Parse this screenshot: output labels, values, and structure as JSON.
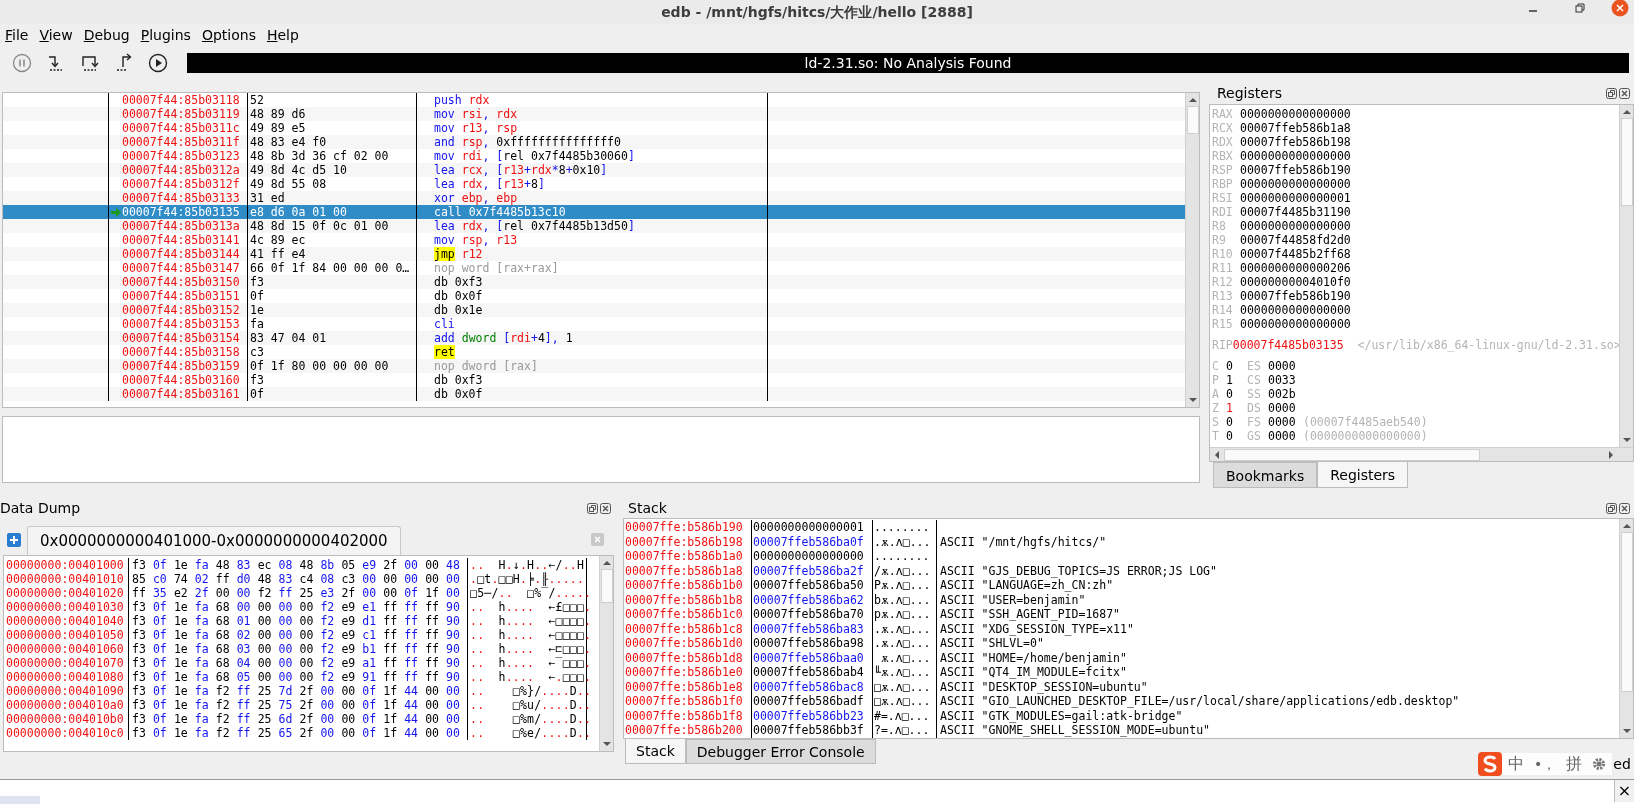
{
  "window": {
    "title": "edb - /mnt/hgfs/hitcs/大作业/hello [2888]"
  },
  "menu": [
    "File",
    "View",
    "Debug",
    "Plugins",
    "Options",
    "Help"
  ],
  "toolbar": {
    "status": "ld-2.31.so: No Analysis Found"
  },
  "disassembly": {
    "rows": [
      {
        "address": "00007f44:85b03118",
        "bytes": "52",
        "asm": [
          {
            "kind": "mnemonic",
            "text": "push "
          },
          {
            "kind": "register",
            "text": "rdx"
          }
        ],
        "selected": false,
        "current": false
      },
      {
        "address": "00007f44:85b03119",
        "bytes": "48 89 d6",
        "asm": [
          {
            "kind": "mnemonic",
            "text": "mov "
          },
          {
            "kind": "register",
            "text": "rsi"
          },
          {
            "kind": "punct",
            "text": ", "
          },
          {
            "kind": "register",
            "text": "rdx"
          }
        ],
        "selected": false,
        "current": false
      },
      {
        "address": "00007f44:85b0311c",
        "bytes": "49 89 e5",
        "asm": [
          {
            "kind": "mnemonic",
            "text": "mov "
          },
          {
            "kind": "register",
            "text": "r13"
          },
          {
            "kind": "punct",
            "text": ", "
          },
          {
            "kind": "register",
            "text": "rsp"
          }
        ],
        "selected": false,
        "current": false
      },
      {
        "address": "00007f44:85b0311f",
        "bytes": "48 83 e4 f0",
        "asm": [
          {
            "kind": "mnemonic",
            "text": "and "
          },
          {
            "kind": "register",
            "text": "rsp"
          },
          {
            "kind": "punct",
            "text": ", "
          },
          {
            "kind": "number",
            "text": "0xfffffffffffffff0"
          }
        ],
        "selected": false,
        "current": false
      },
      {
        "address": "00007f44:85b03123",
        "bytes": "48 8b 3d 36 cf 02 00",
        "asm": [
          {
            "kind": "mnemonic",
            "text": "mov "
          },
          {
            "kind": "register",
            "text": "rdi"
          },
          {
            "kind": "punct",
            "text": ", ["
          },
          {
            "kind": "number",
            "text": "rel 0x7f4485b30060"
          },
          {
            "kind": "punct",
            "text": "]"
          }
        ],
        "selected": false,
        "current": false
      },
      {
        "address": "00007f44:85b0312a",
        "bytes": "49 8d 4c d5 10",
        "asm": [
          {
            "kind": "mnemonic",
            "text": "lea "
          },
          {
            "kind": "register",
            "text": "rcx"
          },
          {
            "kind": "punct",
            "text": ", ["
          },
          {
            "kind": "register",
            "text": "r13"
          },
          {
            "kind": "punct",
            "text": "+"
          },
          {
            "kind": "register",
            "text": "rdx"
          },
          {
            "kind": "punct",
            "text": "*"
          },
          {
            "kind": "number",
            "text": "8"
          },
          {
            "kind": "punct",
            "text": "+"
          },
          {
            "kind": "number",
            "text": "0x10"
          },
          {
            "kind": "punct",
            "text": "]"
          }
        ],
        "selected": false,
        "current": false
      },
      {
        "address": "00007f44:85b0312f",
        "bytes": "49 8d 55 08",
        "asm": [
          {
            "kind": "mnemonic",
            "text": "lea "
          },
          {
            "kind": "register",
            "text": "rdx"
          },
          {
            "kind": "punct",
            "text": ", ["
          },
          {
            "kind": "register",
            "text": "r13"
          },
          {
            "kind": "punct",
            "text": "+"
          },
          {
            "kind": "number",
            "text": "8"
          },
          {
            "kind": "punct",
            "text": "]"
          }
        ],
        "selected": false,
        "current": false
      },
      {
        "address": "00007f44:85b03133",
        "bytes": "31 ed",
        "asm": [
          {
            "kind": "mnemonic",
            "text": "xor "
          },
          {
            "kind": "register",
            "text": "ebp"
          },
          {
            "kind": "punct",
            "text": ", "
          },
          {
            "kind": "register",
            "text": "ebp"
          }
        ],
        "selected": false,
        "current": false
      },
      {
        "address": "00007f44:85b03135",
        "bytes": "e8 d6 0a 01 00",
        "asm": [
          {
            "kind": "mnemonic",
            "text": "call "
          },
          {
            "kind": "number",
            "text": "0x7f4485b13c10"
          }
        ],
        "selected": true,
        "current": true
      },
      {
        "address": "00007f44:85b0313a",
        "bytes": "48 8d 15 0f 0c 01 00",
        "asm": [
          {
            "kind": "mnemonic",
            "text": "lea "
          },
          {
            "kind": "register",
            "text": "rdx"
          },
          {
            "kind": "punct",
            "text": ", ["
          },
          {
            "kind": "number",
            "text": "rel 0x7f4485b13d50"
          },
          {
            "kind": "punct",
            "text": "]"
          }
        ],
        "selected": false,
        "current": false
      },
      {
        "address": "00007f44:85b03141",
        "bytes": "4c 89 ec",
        "asm": [
          {
            "kind": "mnemonic",
            "text": "mov "
          },
          {
            "kind": "register",
            "text": "rsp"
          },
          {
            "kind": "punct",
            "text": ", "
          },
          {
            "kind": "register",
            "text": "r13"
          }
        ],
        "selected": false,
        "current": false
      },
      {
        "address": "00007f44:85b03144",
        "bytes": "41 ff e4",
        "asm": [
          {
            "kind": "highlight",
            "text": "jmp"
          },
          {
            "kind": "register",
            "text": " r12"
          }
        ],
        "selected": false,
        "current": false
      },
      {
        "address": "00007f44:85b03147",
        "bytes": "66 0f 1f 84 00 00 00 0…",
        "asm": [
          {
            "kind": "dim",
            "text": "nop word [rax+rax]"
          }
        ],
        "selected": false,
        "current": false
      },
      {
        "address": "00007f44:85b03150",
        "bytes": "f3",
        "asm": [
          {
            "kind": "number",
            "text": "db 0xf3"
          }
        ],
        "selected": false,
        "current": false
      },
      {
        "address": "00007f44:85b03151",
        "bytes": "0f",
        "asm": [
          {
            "kind": "number",
            "text": "db 0x0f"
          }
        ],
        "selected": false,
        "current": false
      },
      {
        "address": "00007f44:85b03152",
        "bytes": "1e",
        "asm": [
          {
            "kind": "number",
            "text": "db 0x1e"
          }
        ],
        "selected": false,
        "current": false
      },
      {
        "address": "00007f44:85b03153",
        "bytes": "fa",
        "asm": [
          {
            "kind": "mnemonic",
            "text": "cli"
          }
        ],
        "selected": false,
        "current": false
      },
      {
        "address": "00007f44:85b03154",
        "bytes": "83 47 04 01",
        "asm": [
          {
            "kind": "mnemonic",
            "text": "add "
          },
          {
            "kind": "size",
            "text": "dword "
          },
          {
            "kind": "punct",
            "text": "["
          },
          {
            "kind": "register",
            "text": "rdi"
          },
          {
            "kind": "punct",
            "text": "+"
          },
          {
            "kind": "number",
            "text": "4"
          },
          {
            "kind": "punct",
            "text": "], "
          },
          {
            "kind": "number",
            "text": "1"
          }
        ],
        "selected": false,
        "current": false
      },
      {
        "address": "00007f44:85b03158",
        "bytes": "c3",
        "asm": [
          {
            "kind": "highlight",
            "text": "ret"
          }
        ],
        "selected": false,
        "current": false
      },
      {
        "address": "00007f44:85b03159",
        "bytes": "0f 1f 80 00 00 00 00",
        "asm": [
          {
            "kind": "dim",
            "text": "nop dword [rax]"
          }
        ],
        "selected": false,
        "current": false
      },
      {
        "address": "00007f44:85b03160",
        "bytes": "f3",
        "asm": [
          {
            "kind": "number",
            "text": "db 0xf3"
          }
        ],
        "selected": false,
        "current": false
      },
      {
        "address": "00007f44:85b03161",
        "bytes": "0f",
        "asm": [
          {
            "kind": "number",
            "text": "db 0x0f"
          }
        ],
        "selected": false,
        "current": false
      }
    ]
  },
  "registers": {
    "title": "Registers",
    "general": [
      {
        "name": "RAX",
        "value": "0000000000000000"
      },
      {
        "name": "RCX",
        "value": "00007ffeb586b1a8"
      },
      {
        "name": "RDX",
        "value": "00007ffeb586b198"
      },
      {
        "name": "RBX",
        "value": "0000000000000000"
      },
      {
        "name": "RSP",
        "value": "00007ffeb586b190"
      },
      {
        "name": "RBP",
        "value": "0000000000000000"
      },
      {
        "name": "RSI",
        "value": "0000000000000001"
      },
      {
        "name": "RDI",
        "value": "00007f4485b31190"
      },
      {
        "name": "R8",
        "value": "0000000000000000"
      },
      {
        "name": "R9",
        "value": "00007f44858fd2d0"
      },
      {
        "name": "R10",
        "value": "00007f4485b2ff68"
      },
      {
        "name": "R11",
        "value": "0000000000000206"
      },
      {
        "name": "R12",
        "value": "00000000004010f0"
      },
      {
        "name": "R13",
        "value": "00007ffeb586b190"
      },
      {
        "name": "R14",
        "value": "0000000000000000"
      },
      {
        "name": "R15",
        "value": "0000000000000000"
      }
    ],
    "rip": {
      "name": "RIP",
      "value": "00007f4485b03135",
      "comment": "</usr/lib/x86_64-linux-gnu/ld-2.31.so>"
    },
    "flags": [
      {
        "flag": "C",
        "value": "0",
        "changed": false,
        "segment": "ES",
        "segment_value": "0000"
      },
      {
        "flag": "P",
        "value": "1",
        "changed": false,
        "segment": "CS",
        "segment_value": "0033"
      },
      {
        "flag": "A",
        "value": "0",
        "changed": false,
        "segment": "SS",
        "segment_value": "002b"
      },
      {
        "flag": "Z",
        "value": "1",
        "changed": true,
        "segment": "DS",
        "segment_value": "0000"
      },
      {
        "flag": "S",
        "value": "0",
        "changed": false,
        "segment": "FS",
        "segment_value": "0000",
        "base": "(00007f4485aeb540)"
      },
      {
        "flag": "T",
        "value": "0",
        "changed": false,
        "segment": "GS",
        "segment_value": "0000",
        "base": "(0000000000000000)"
      }
    ]
  },
  "side_tabs": [
    {
      "label": "Bookmarks",
      "selected": false
    },
    {
      "label": "Registers",
      "selected": true
    }
  ],
  "data_dump": {
    "title": "Data Dump",
    "tab": "0x0000000000401000-0x0000000000402000",
    "rows": [
      {
        "address": "00000000:00401000",
        "bytes": "f3 0f 1e fa 48 83 ec 08 48 8b 05 e9 2f 00 00 48",
        "ascii": "..  H.↓.H..←/..H"
      },
      {
        "address": "00000000:00401010",
        "bytes": "85 c0 74 02 ff d0 48 83 c4 08 c3 00 00 00 00 00",
        "ascii": ".□t.□□H.╞.╟....."
      },
      {
        "address": "00000000:00401020",
        "bytes": "ff 35 e2 2f 00 00 f2 ff 25 e3 2f 00 00 0f 1f 00",
        "ascii": "□5─/..  □%‾/....."
      },
      {
        "address": "00000000:00401030",
        "bytes": "f3 0f 1e fa 68 00 00 00 00 f2 e9 e1 ff ff ff 90",
        "ascii": "..  h....  ←£□□□."
      },
      {
        "address": "00000000:00401040",
        "bytes": "f3 0f 1e fa 68 01 00 00 00 f2 e9 d1 ff ff ff 90",
        "ascii": "..  h....  ←□□□□."
      },
      {
        "address": "00000000:00401050",
        "bytes": "f3 0f 1e fa 68 02 00 00 00 f2 e9 c1 ff ff ff 90",
        "ascii": "..  h....  ←□□□□."
      },
      {
        "address": "00000000:00401060",
        "bytes": "f3 0f 1e fa 68 03 00 00 00 f2 e9 b1 ff ff ff 90",
        "ascii": "..  h....  ←⊏□□□."
      },
      {
        "address": "00000000:00401070",
        "bytes": "f3 0f 1e fa 68 04 00 00 00 f2 e9 a1 ff ff ff 90",
        "ascii": "..  h....  ←‾□□□."
      },
      {
        "address": "00000000:00401080",
        "bytes": "f3 0f 1e fa 68 05 00 00 00 f2 e9 91 ff ff ff 90",
        "ascii": "..  h....  ←.□□□."
      },
      {
        "address": "00000000:00401090",
        "bytes": "f3 0f 1e fa f2 ff 25 7d 2f 00 00 0f 1f 44 00 00",
        "ascii": "..    □%}/....D.."
      },
      {
        "address": "00000000:004010a0",
        "bytes": "f3 0f 1e fa f2 ff 25 75 2f 00 00 0f 1f 44 00 00",
        "ascii": "..    □%u/....D.."
      },
      {
        "address": "00000000:004010b0",
        "bytes": "f3 0f 1e fa f2 ff 25 6d 2f 00 00 0f 1f 44 00 00",
        "ascii": "..    □%m/....D.."
      },
      {
        "address": "00000000:004010c0",
        "bytes": "f3 0f 1e fa f2 ff 25 65 2f 00 00 0f 1f 44 00 00",
        "ascii": "..    □%e/....D.."
      }
    ]
  },
  "stack": {
    "title": "Stack",
    "rows": [
      {
        "address": "00007ffe:b586b190",
        "value": "0000000000000001",
        "ascii": "........"
      },
      {
        "address": "00007ffe:b586b198",
        "value": "00007ffeb586ba0f",
        "ascii": ".ѫ.ʌ□...",
        "comment": "ASCII \"/mnt/hgfs/hitcs/\""
      },
      {
        "address": "00007ffe:b586b1a0",
        "value": "0000000000000000",
        "ascii": "........"
      },
      {
        "address": "00007ffe:b586b1a8",
        "value": "00007ffeb586ba2f",
        "ascii": "/ѫ.ʌ□...",
        "comment": "ASCII \"GJS_DEBUG_TOPICS=JS ERROR;JS LOG\""
      },
      {
        "address": "00007ffe:b586b1b0",
        "value": "00007ffeb586ba50",
        "ascii": "Pѫ.ʌ□...",
        "comment": "ASCII \"LANGUAGE=zh_CN:zh\""
      },
      {
        "address": "00007ffe:b586b1b8",
        "value": "00007ffeb586ba62",
        "ascii": "bѫ.ʌ□...",
        "comment": "ASCII \"USER=benjamin\""
      },
      {
        "address": "00007ffe:b586b1c0",
        "value": "00007ffeb586ba70",
        "ascii": "pѫ.ʌ□...",
        "comment": "ASCII \"SSH_AGENT_PID=1687\""
      },
      {
        "address": "00007ffe:b586b1c8",
        "value": "00007ffeb586ba83",
        "ascii": ".ѫ.ʌ□...",
        "comment": "ASCII \"XDG_SESSION_TYPE=x11\""
      },
      {
        "address": "00007ffe:b586b1d0",
        "value": "00007ffeb586ba98",
        "ascii": ".ѫ.ʌ□...",
        "comment": "ASCII \"SHLVL=0\""
      },
      {
        "address": "00007ffe:b586b1d8",
        "value": "00007ffeb586baa0",
        "ascii": " ѫ.ʌ□...",
        "comment": "ASCII \"HOME=/home/benjamin\""
      },
      {
        "address": "00007ffe:b586b1e0",
        "value": "00007ffeb586bab4",
        "ascii": "╙ѫ.ʌ□...",
        "comment": "ASCII \"QT4_IM_MODULE=fcitx\""
      },
      {
        "address": "00007ffe:b586b1e8",
        "value": "00007ffeb586bac8",
        "ascii": "□ѫ.ʌ□...",
        "comment": "ASCII \"DESKTOP_SESSION=ubuntu\""
      },
      {
        "address": "00007ffe:b586b1f0",
        "value": "00007ffeb586badf",
        "ascii": "□ѫ.ʌ□...",
        "comment": "ASCII \"GIO_LAUNCHED_DESKTOP_FILE=/usr/local/share/applications/edb.desktop\""
      },
      {
        "address": "00007ffe:b586b1f8",
        "value": "00007ffeb586bb23",
        "ascii": "#=.ʌ□...",
        "comment": "ASCII \"GTK_MODULES=gail:atk-bridge\""
      },
      {
        "address": "00007ffe:b586b200",
        "value": "00007ffeb586bb3f",
        "ascii": "?=.ʌ□...",
        "comment": "ASCII \"GNOME_SHELL_SESSION_MODE=ubuntu\""
      }
    ]
  },
  "bottom_tabs": [
    {
      "label": "Stack",
      "selected": true
    },
    {
      "label": "Debugger Error Console",
      "selected": false
    }
  ],
  "input_method_bar": {
    "mode": "中",
    "punctuation": "•，",
    "layout": "拼"
  },
  "status_fragment": "ed",
  "panel_close_glyph": "×"
}
